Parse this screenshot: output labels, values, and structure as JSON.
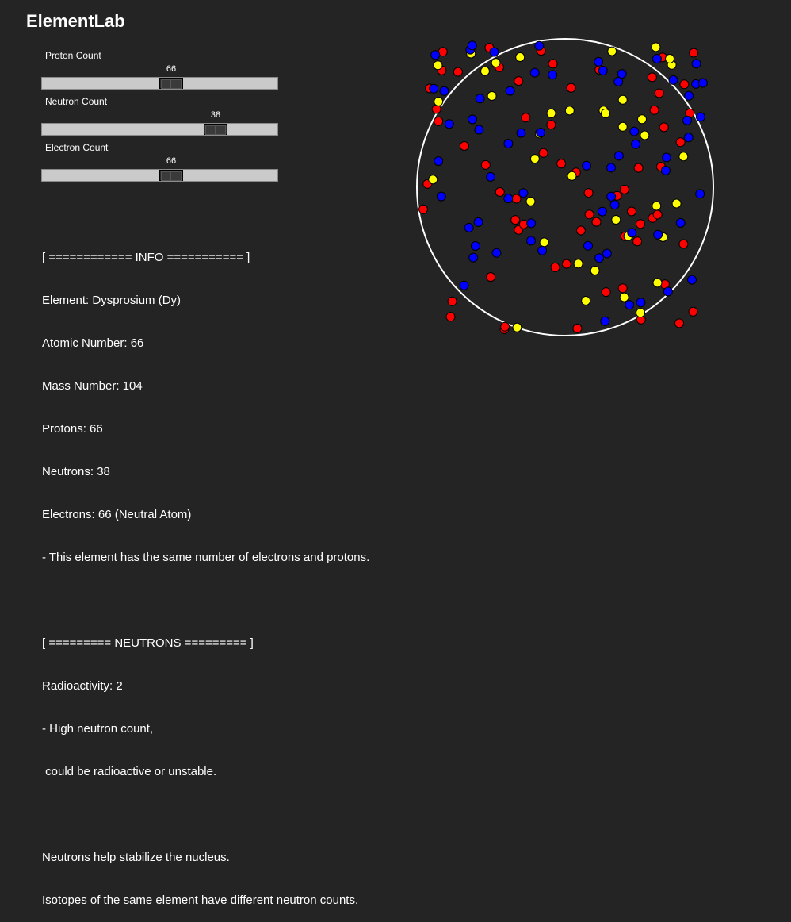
{
  "app": {
    "title": "ElementLab"
  },
  "sliders": [
    {
      "label": "Proton Count",
      "value": "66",
      "fraction": 0.55
    },
    {
      "label": "Neutron Count",
      "value": "38",
      "fraction": 0.735
    },
    {
      "label": "Electron Count",
      "value": "66",
      "fraction": 0.55
    }
  ],
  "info": {
    "header": "[ ============ INFO =========== ]",
    "element": "Element: Dysprosium (Dy)",
    "atomic_number": "Atomic Number: 66",
    "mass_number": "Mass Number: 104",
    "protons": "Protons: 66",
    "neutrons": "Neutrons: 38",
    "electrons": "Electrons: 66 (Neutral Atom)",
    "note": "- This element has the same number of electrons and protons."
  },
  "neutrons_section": {
    "header": "[ ========= NEUTRONS ========= ]",
    "radioactivity": "Radioactivity: 2",
    "note_line1": "- High neutron count,",
    "note_line2": " could be radioactive or unstable."
  },
  "footer": {
    "line1": "Neutrons help stabilize the nucleus.",
    "line2": "Isotopes of the same element have different neutron counts."
  },
  "colors": {
    "background": "#242424",
    "proton": "#ff0000",
    "neutron": "#ffff00",
    "electron": "#0000ff",
    "orbit": "#ffffff"
  }
}
